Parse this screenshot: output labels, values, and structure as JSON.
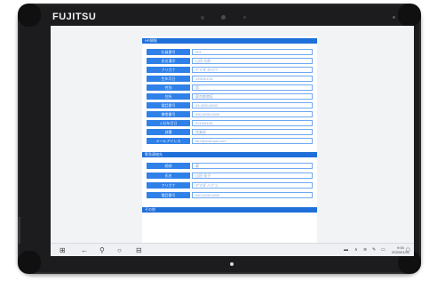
{
  "device": {
    "brand_logo": "FUJITSU"
  },
  "form": {
    "section1_title": "HR情報",
    "section1_rows": [
      {
        "label": "社員番号",
        "value": "001"
      },
      {
        "label": "氏名漢字",
        "value": "山田 太郎"
      },
      {
        "label": "フリガナ",
        "value": "ヤマダ タロウ"
      },
      {
        "label": "生年月日",
        "value": "1990/01/01"
      },
      {
        "label": "性別",
        "value": "男"
      },
      {
        "label": "住所",
        "value": "東京都港区"
      },
      {
        "label": "電話番号",
        "value": "03-0000-0000"
      },
      {
        "label": "携帯番号",
        "value": "090-0000-0000"
      },
      {
        "label": "入社年月日",
        "value": "2015/04/01"
      },
      {
        "label": "部署",
        "value": "営業部"
      },
      {
        "label": "メールアドレス",
        "value": "taro@example.com"
      }
    ],
    "section2_title": "緊急連絡先",
    "section2_rows": [
      {
        "label": "続柄",
        "value": "妻"
      },
      {
        "label": "氏名",
        "value": "山田 花子"
      },
      {
        "label": "フリガナ",
        "value": "ヤマダ ハナコ"
      },
      {
        "label": "電話番号",
        "value": "090-0000-0000"
      }
    ],
    "section3_title": "その他"
  },
  "taskbar": {
    "start_icon": "windows-icon",
    "back_icon": "back-icon",
    "search_icon": "search-icon",
    "task_view_icon": "task-view-icon",
    "grid_icon": "grid-icon",
    "time": "9:00",
    "date": "2020/01/01"
  }
}
